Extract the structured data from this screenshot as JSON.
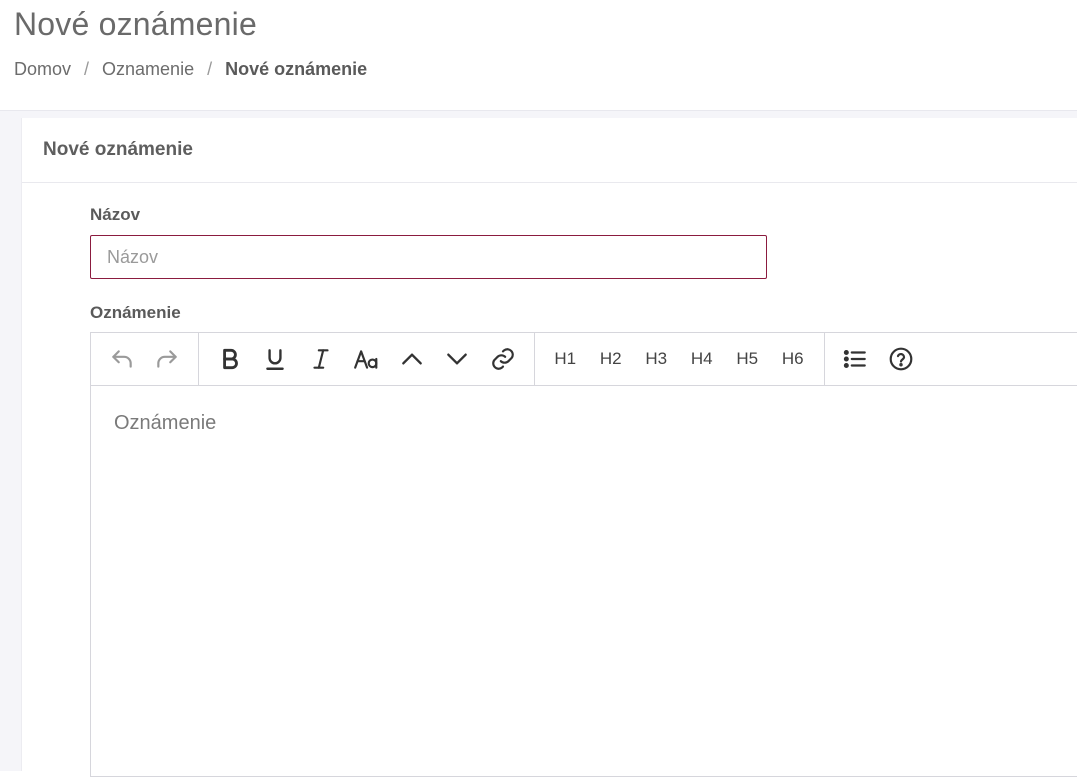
{
  "header": {
    "title": "Nové oznámenie",
    "breadcrumb": [
      "Domov",
      "Oznamenie",
      "Nové oznámenie"
    ],
    "breadcrumb_separator": "/"
  },
  "card": {
    "title": "Nové oznámenie",
    "name_field": {
      "label": "Názov",
      "placeholder": "Názov",
      "value": ""
    },
    "announcement_field": {
      "label": "Oznámenie",
      "placeholder": "Oznámenie"
    }
  },
  "toolbar": {
    "history": [
      "undo-icon",
      "redo-icon"
    ],
    "formatting": [
      "bold-icon",
      "underline-icon",
      "italic-icon",
      "font-size-icon",
      "superscript-icon",
      "subscript-icon",
      "link-icon"
    ],
    "headings": [
      "H1",
      "H2",
      "H3",
      "H4",
      "H5",
      "H6"
    ],
    "extras": [
      "bullet-list-icon",
      "help-icon"
    ]
  },
  "colors": {
    "accent_border": "#8b1b3f",
    "page_background": "#f5f5f9"
  }
}
